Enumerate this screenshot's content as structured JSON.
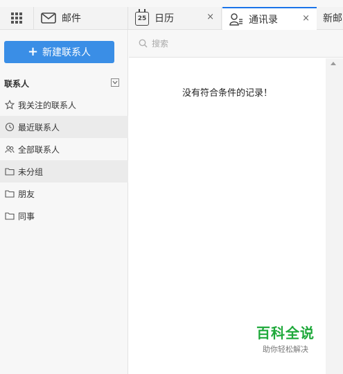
{
  "tabs": {
    "mail": "邮件",
    "calendar": "日历",
    "calendar_day": "25",
    "contacts": "通讯录",
    "more": "新邮",
    "close_glyph": "×"
  },
  "sidebar": {
    "new_contact_label": "新建联系人",
    "section_title": "联系人",
    "items": [
      {
        "label": "我关注的联系人",
        "icon": "star-icon"
      },
      {
        "label": "最近联系人",
        "icon": "clock-icon"
      },
      {
        "label": "全部联系人",
        "icon": "people-icon"
      },
      {
        "label": "未分组",
        "icon": "folder-icon"
      },
      {
        "label": "朋友",
        "icon": "folder-icon"
      },
      {
        "label": "同事",
        "icon": "folder-icon"
      }
    ]
  },
  "search": {
    "placeholder": "搜索"
  },
  "main": {
    "empty_message": "没有符合条件的记录！"
  },
  "watermark": {
    "title": "百科全说",
    "subtitle": "助你轻松解决"
  },
  "colors": {
    "accent": "#3a8ee6",
    "tab_indicator": "#1a73e8",
    "watermark_green": "#1fa93b"
  }
}
